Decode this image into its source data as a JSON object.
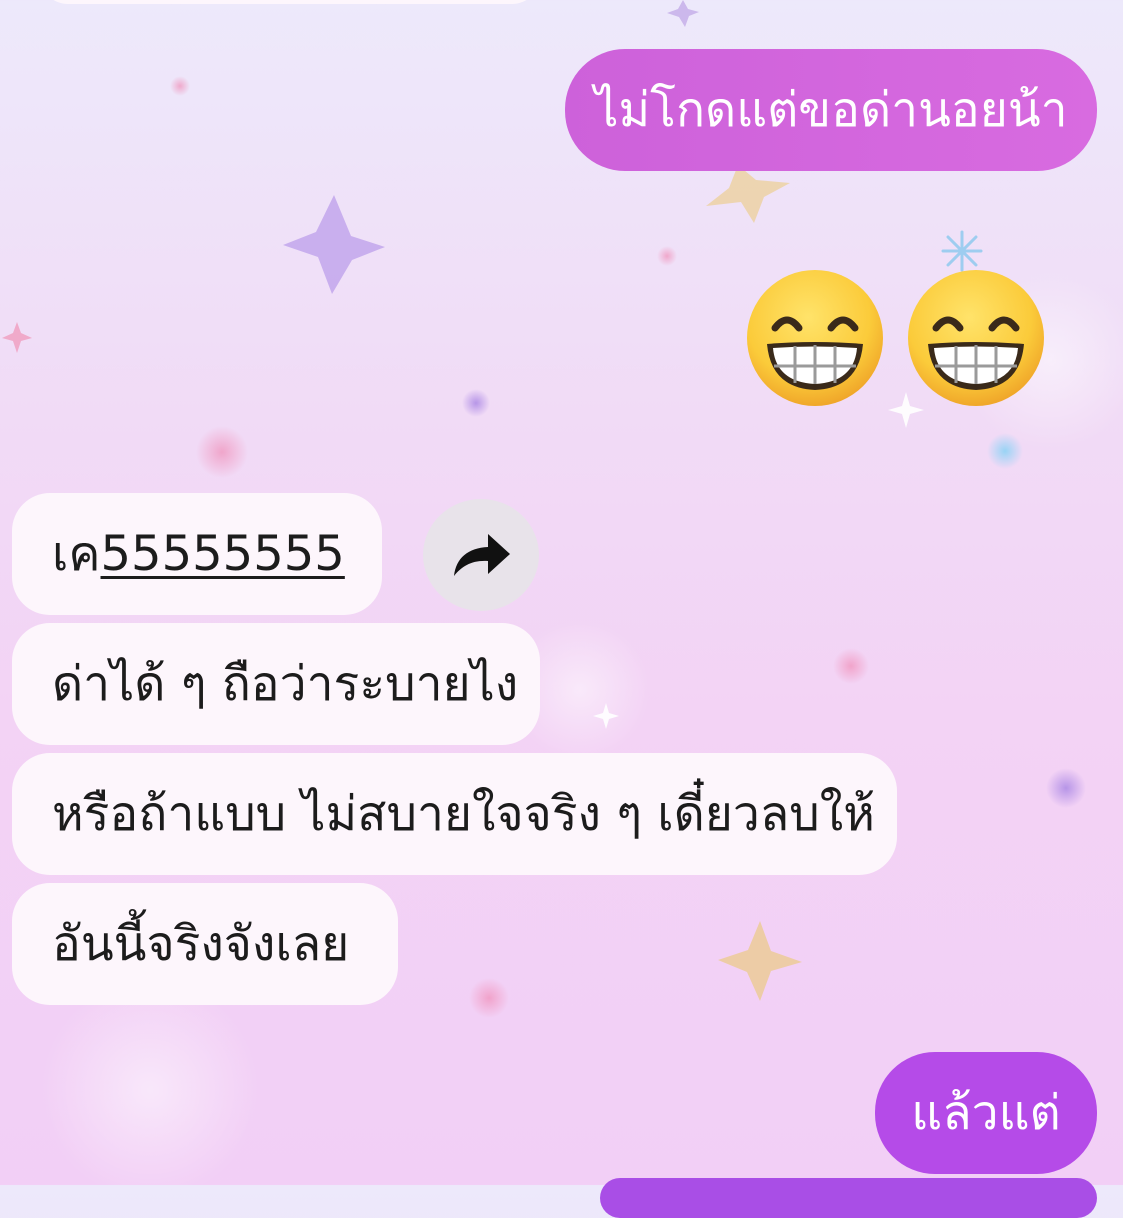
{
  "chat": {
    "messages": [
      {
        "direction": "outgoing",
        "text": "ไม่โกดแต่ขอด่านอยน้า"
      },
      {
        "direction": "outgoing",
        "type": "emoji",
        "emoji": [
          "grinning-face-with-smiling-eyes",
          "grinning-face-with-smiling-eyes"
        ]
      },
      {
        "direction": "incoming",
        "prefix": "เค",
        "link_text": "55555555"
      },
      {
        "direction": "incoming",
        "text": "ด่าได้ ๆ ถือว่าระบายไง"
      },
      {
        "direction": "incoming",
        "text": "หรือถ้าแบบ ไม่สบายใจจริง ๆ เดี๋ยวลบให้"
      },
      {
        "direction": "incoming",
        "text": "อันนี้จริงจังเลย"
      },
      {
        "direction": "outgoing",
        "text": "แล้วแต่"
      }
    ],
    "share_icon": "share-arrow-icon"
  },
  "colors": {
    "outgoing_bubble": "#d066dc",
    "outgoing_bubble_alt": "#b54be8",
    "incoming_bubble": "#fdf6fc",
    "background_top": "#ede9fb",
    "background_bottom": "#f2cff6"
  }
}
